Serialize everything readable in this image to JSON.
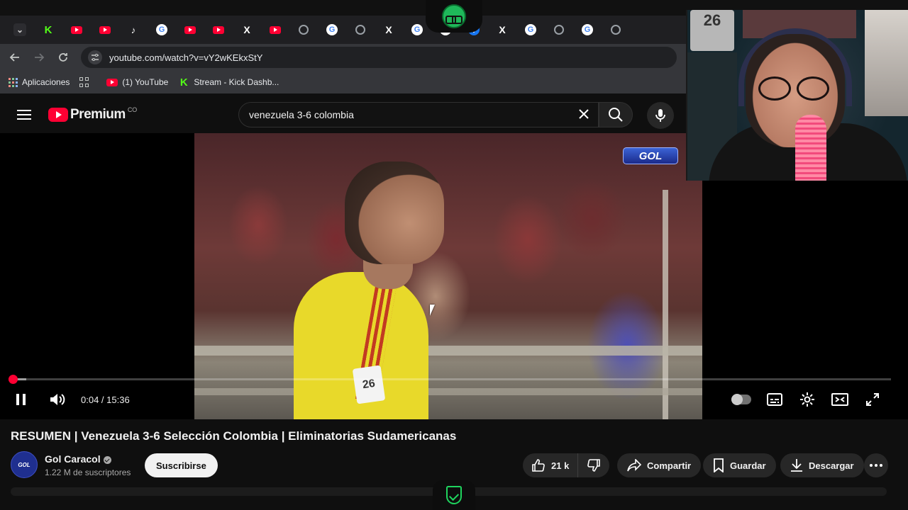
{
  "browser": {
    "tabs": [
      {
        "icon": "chevron-down-icon"
      },
      {
        "icon": "kick-icon"
      },
      {
        "icon": "youtube-icon"
      },
      {
        "icon": "youtube-icon"
      },
      {
        "icon": "tiktok-icon"
      },
      {
        "icon": "google-icon"
      },
      {
        "icon": "youtube-icon"
      },
      {
        "icon": "youtube-icon"
      },
      {
        "icon": "x-icon"
      },
      {
        "icon": "youtube-icon"
      },
      {
        "icon": "globe-icon"
      },
      {
        "icon": "google-icon"
      },
      {
        "icon": "globe-icon"
      },
      {
        "icon": "x-icon"
      },
      {
        "icon": "google-icon"
      },
      {
        "icon": "google-icon"
      },
      {
        "icon": "facebook-icon"
      },
      {
        "icon": "x-icon"
      },
      {
        "icon": "google-icon"
      },
      {
        "icon": "globe-icon"
      },
      {
        "icon": "google-icon"
      },
      {
        "icon": "globe-icon"
      }
    ],
    "url": "youtube.com/watch?v=vY2wKEkxStY",
    "bookmarks": {
      "apps": "Aplicaciones",
      "youtube": "(1) YouTube",
      "kick": "Stream - Kick Dashb..."
    }
  },
  "youtube": {
    "logo_text": "Premium",
    "country_code": "CO",
    "search_query": "venezuela 3-6 colombia"
  },
  "player": {
    "channel_overlay": "GOL",
    "jersey_number": "26",
    "current_time": "0:04",
    "duration": "15:36",
    "time_display": "0:04 / 15:36",
    "progress_fraction": 0.0043,
    "buffer_fraction": 0.02
  },
  "video": {
    "title": "RESUMEN | Venezuela 3-6 Selección Colombia | Eliminatorias Sudamericanas",
    "channel_name": "Gol Caracol",
    "channel_avatar_text": "GOL",
    "subscribers": "1.22 M de suscriptores",
    "subscribe_label": "Suscribirse",
    "likes": "21 k",
    "share_label": "Compartir",
    "save_label": "Guardar",
    "download_label": "Descargar"
  },
  "webcam": {
    "jersey_number": "26"
  },
  "colors": {
    "youtube_red": "#ff0033",
    "kick_green": "#53fc18",
    "background": "#0f0f0f"
  }
}
